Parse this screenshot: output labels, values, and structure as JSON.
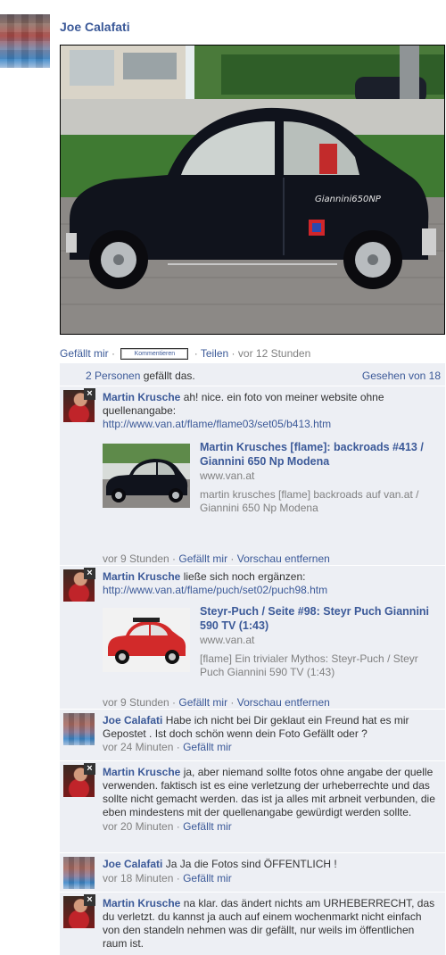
{
  "post": {
    "author": "Joe Calafati",
    "actions": {
      "like": "Gefällt mir",
      "comment": "Kommentieren",
      "share": "Teilen",
      "time": "vor 12 Stunden"
    },
    "likes": {
      "people_link": "2 Personen",
      "text": " gefällt das.",
      "seen": "Gesehen von 18"
    }
  },
  "comments": [
    {
      "author": "Martin Krusche",
      "text": "ah! nice. ein foto von meiner website ohne quellenangabe:",
      "link": "http://www.van.at/flame/flame03/set05/b413.htm",
      "preview": {
        "title": "Martin Krusches [flame]: backroads #413 / Giannini 650 Np Modena",
        "domain": "www.van.at",
        "desc": "martin krusches [flame] backroads auf van.at / Giannini 650 Np Modena"
      },
      "time": "vor 9 Stunden",
      "like": "Gefällt mir",
      "remove": "Vorschau entfernen"
    },
    {
      "author": "Martin Krusche",
      "text": "ließe sich noch ergänzen:",
      "link": "http://www.van.at/flame/puch/set02/puch98.htm",
      "preview": {
        "title": "Steyr-Puch / Seite #98: Steyr Puch Giannini 590 TV (1:43)",
        "domain": "www.van.at",
        "desc": "[flame] Ein trivialer Mythos: Steyr-Puch / Steyr Puch Giannini 590 TV (1:43)"
      },
      "time": "vor 9 Stunden",
      "like": "Gefällt mir",
      "remove": "Vorschau entfernen"
    },
    {
      "author": "Joe Calafati",
      "text": "Habe ich nicht bei Dir geklaut ein Freund hat es mir Gepostet . Ist doch schön wenn dein Foto Gefällt oder ?",
      "time": "vor 24 Minuten",
      "like": "Gefällt mir"
    },
    {
      "author": "Martin Krusche",
      "text": "ja, aber niemand sollte fotos ohne angabe der quelle verwenden. faktisch ist es eine verletzung der urheberrechte und das sollte nicht gemacht werden. das ist ja alles mit arbneit verbunden, die eben mindestens mit der quellenangabe gewürdigt werden sollte.",
      "time": "vor 20 Minuten",
      "like": "Gefällt mir"
    },
    {
      "author": "Joe Calafati",
      "text": "Ja Ja die Fotos sind ÖFFENTLICH !",
      "time": "vor 18 Minuten",
      "like": "Gefällt mir"
    },
    {
      "author": "Martin Krusche",
      "text": "na klar. das ändert nichts am URHEBERRECHT, das du verletzt. du kannst ja auch auf einem wochenmarkt nicht einfach von den standeln nehmen was dir gefällt, nur weils im öffentlichen raum ist."
    }
  ],
  "colors": {
    "link": "#3b5998",
    "meta": "#808080",
    "feed_bg": "#edeff4"
  }
}
